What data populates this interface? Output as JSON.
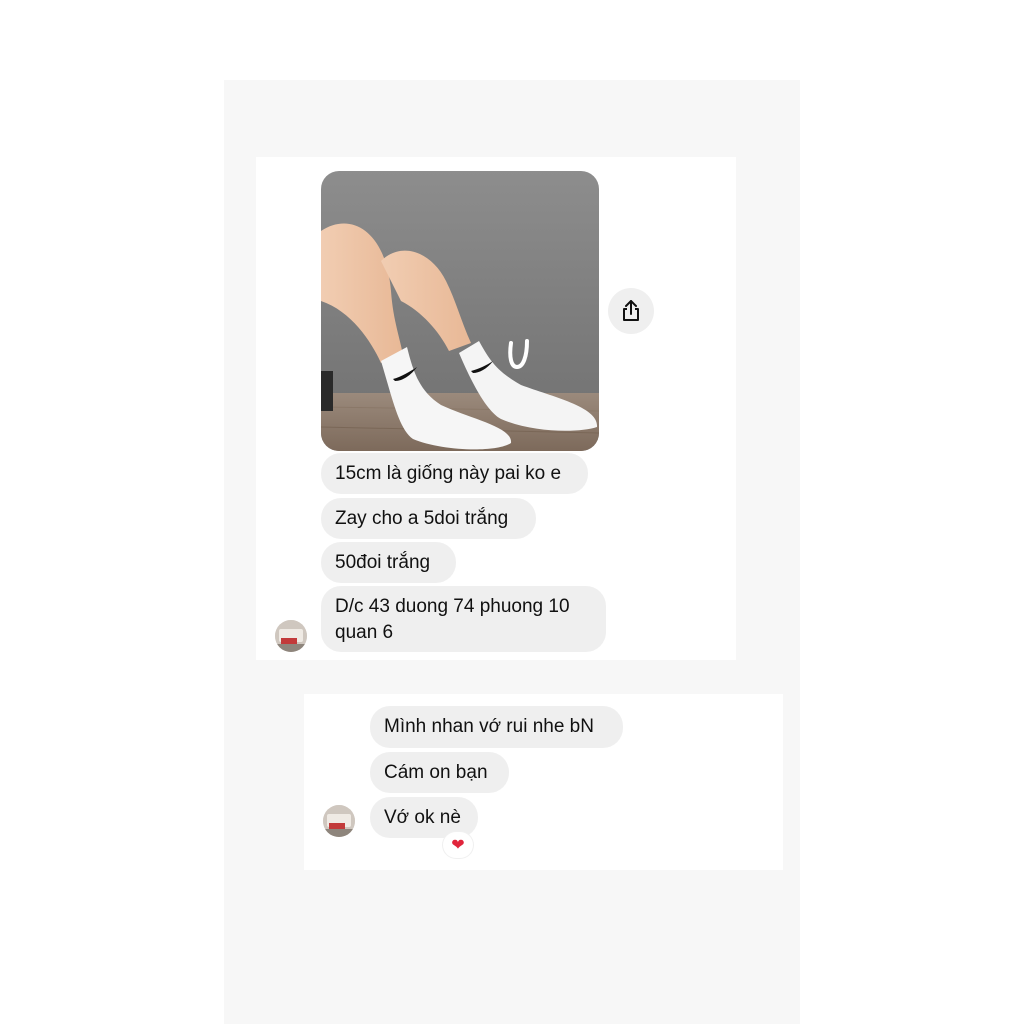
{
  "thread_1": {
    "messages": [
      {
        "text": "15cm là giống này pai ko e"
      },
      {
        "text": "Zay cho a 5doi trắng"
      },
      {
        "text": "50đoi trắng"
      },
      {
        "text": "D/c 43 duong 74 phuong 10 quan 6"
      }
    ],
    "photo": {
      "handwritten_mark": "U",
      "icon": "photo-socks"
    },
    "share": {
      "icon": "share-icon"
    },
    "avatar": {
      "icon": "avatar-image"
    }
  },
  "thread_2": {
    "messages": [
      {
        "text": "Mình nhan vớ rui nhe bN"
      },
      {
        "text": "Cám on bạn"
      },
      {
        "text": "Vớ ok nè"
      }
    ],
    "reaction": {
      "emoji": "❤",
      "icon": "heart-icon"
    },
    "avatar": {
      "icon": "avatar-image"
    }
  },
  "colors": {
    "bubble": "#efefef",
    "background": "#f7f7f7",
    "heart": "#e0243b"
  }
}
